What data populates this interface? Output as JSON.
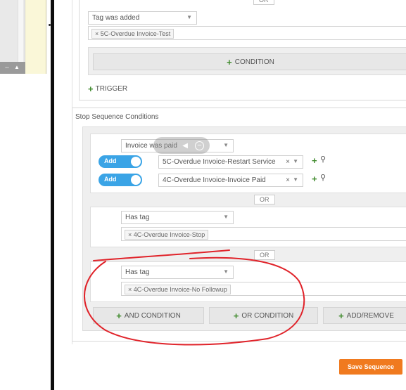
{
  "trigger_section": {
    "or_label": "OR",
    "trigger_select": "Tag was added",
    "trigger_tag": "× 5C-Overdue Invoice-Test",
    "condition_button": "CONDITION",
    "trigger_button": "TRIGGER"
  },
  "stop_conditions": {
    "section_title": "Stop Sequence Conditions",
    "group1": {
      "select": "Invoice was paid",
      "rows": [
        {
          "toggle_label": "Add",
          "value": "5C-Overdue Invoice-Restart Service",
          "clear": "×"
        },
        {
          "toggle_label": "Add",
          "value": "4C-Overdue Invoice-Invoice Paid",
          "clear": "×"
        }
      ]
    },
    "or_1": "OR",
    "group2": {
      "select": "Has tag",
      "tag": "× 4C-Overdue Invoice-Stop"
    },
    "or_2": "OR",
    "group3": {
      "select": "Has tag",
      "tag": "× 4C-Overdue Invoice-No Followup"
    },
    "and_condition": "AND CONDITION",
    "or_condition": "OR CONDITION",
    "add_remove": "ADD/REMOVE"
  },
  "save_button": "Save Sequence",
  "colors": {
    "accent_orange": "#f07a1f",
    "toggle_blue": "#3aa4e6",
    "annotation_red": "#e0232a",
    "plus_green": "#3f8a2c"
  }
}
